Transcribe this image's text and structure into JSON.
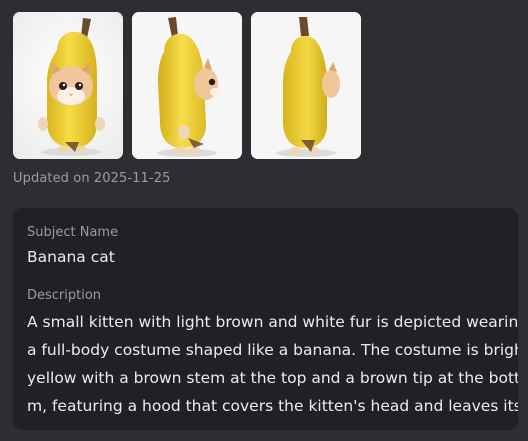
{
  "gallery": {
    "images": [
      {
        "alt": "Banana cat front view",
        "view": "front"
      },
      {
        "alt": "Banana cat side view",
        "view": "side"
      },
      {
        "alt": "Banana cat back view",
        "view": "back"
      }
    ],
    "updated_text": "Updated on 2025-11-25"
  },
  "details": {
    "subject_label": "Subject Name",
    "subject_value": "Banana cat",
    "description_label": "Description",
    "description_lines": [
      "A small kitten with light brown and white fur is depicted wearing",
      "a full-body costume shaped like a banana. The costume is bright",
      "yellow with a brown stem at the top and a brown tip at the botto",
      "m, featuring a hood that covers the kitten's head and leaves its f"
    ]
  },
  "colors": {
    "background": "#2d2e31",
    "card": "#202124",
    "banana": "#f2d23a",
    "stem": "#6b4a2b",
    "fur": "#e8b98a"
  }
}
